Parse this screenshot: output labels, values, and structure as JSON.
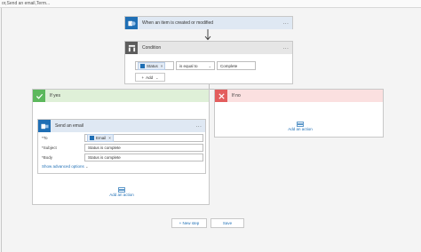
{
  "window": {
    "title": "or,Send an email,Term..."
  },
  "trigger": {
    "label": "When an item is created or modified",
    "more": "..."
  },
  "condition": {
    "label": "Condition",
    "more": "...",
    "field_token": "Status",
    "operator": "is equal to",
    "value": "Complete",
    "add_label": "Add"
  },
  "if_yes": {
    "label": "If yes",
    "action": {
      "label": "Send an email",
      "more": "...",
      "to_label": "*To",
      "to_token": "Email",
      "subject_label": "*Subject",
      "subject_value": "Status is complete",
      "body_label": "*Body",
      "body_value": "Status is complete",
      "advanced_link": "Show advanced options"
    },
    "add_action": "Add an action"
  },
  "if_no": {
    "label": "If no",
    "add_action": "Add an action"
  },
  "footer": {
    "new_step": "+ New step",
    "save": "Save"
  },
  "colors": {
    "accent": "#1f6fb5",
    "yes": "#5cb85c",
    "no": "#e35d5d"
  }
}
